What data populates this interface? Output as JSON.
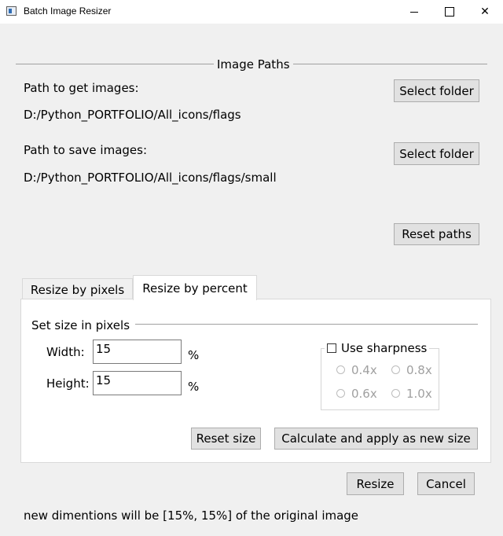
{
  "window": {
    "title": "Batch Image Resizer",
    "controls": {
      "minimize": "–",
      "close": "✕"
    }
  },
  "image_paths": {
    "group_title": "Image Paths",
    "get_label": "Path to get images:",
    "get_path": "D:/Python_PORTFOLIO/All_icons/flags",
    "save_label": "Path to save images:",
    "save_path": "D:/Python_PORTFOLIO/All_icons/flags/small",
    "select_folder_label": "Select folder",
    "reset_paths_label": "Reset paths"
  },
  "tabs": [
    {
      "label": "Resize by pixels",
      "active": false
    },
    {
      "label": "Resize by percent",
      "active": true
    }
  ],
  "size_group": {
    "title": "Set size in pixels",
    "width_label": "Width:",
    "width_value": "15",
    "height_label": "Height:",
    "height_value": "15",
    "unit": "%"
  },
  "sharpness": {
    "label": "Use sharpness",
    "checked": false,
    "options": [
      "0.4x",
      "0.8x",
      "0.6x",
      "1.0x"
    ]
  },
  "buttons": {
    "reset_size": "Reset size",
    "calculate_apply": "Calculate and apply as new size",
    "resize": "Resize",
    "cancel": "Cancel"
  },
  "status_text": "new dimentions will be [15%, 15%] of the original image",
  "colors": {
    "window_bg": "#f0f0f0",
    "button_bg": "#e1e1e1",
    "button_border": "#adadad",
    "disabled_text": "#a0a0a0"
  }
}
